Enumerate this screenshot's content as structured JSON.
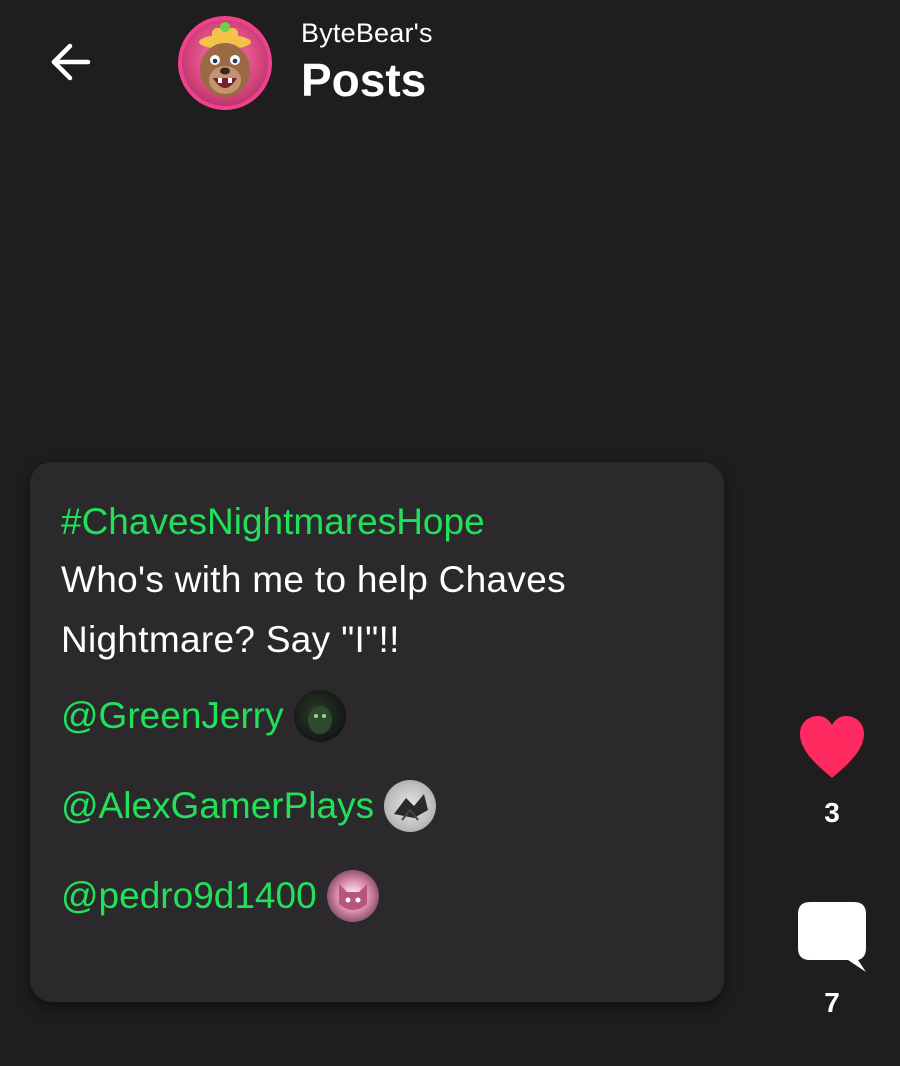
{
  "header": {
    "back_icon": "arrow-left-icon",
    "subtitle": "ByteBear's",
    "title": "Posts"
  },
  "post": {
    "hashtag": "#ChavesNightmaresHope",
    "body": "Who's with me to help Chaves Nightmare? Say \"I\"!!",
    "mentions": [
      {
        "name": "@GreenJerry"
      },
      {
        "name": "@AlexGamerPlays"
      },
      {
        "name": "@pedro9d1400"
      }
    ]
  },
  "actions": {
    "like_icon": "heart-icon",
    "like_count": "3",
    "comment_icon": "comment-bubble-icon",
    "comment_count": "7"
  },
  "colors": {
    "background": "#1f1d1e",
    "card": "#2c292c",
    "accent_green": "#21e05a",
    "heart": "#ff2a5f"
  }
}
